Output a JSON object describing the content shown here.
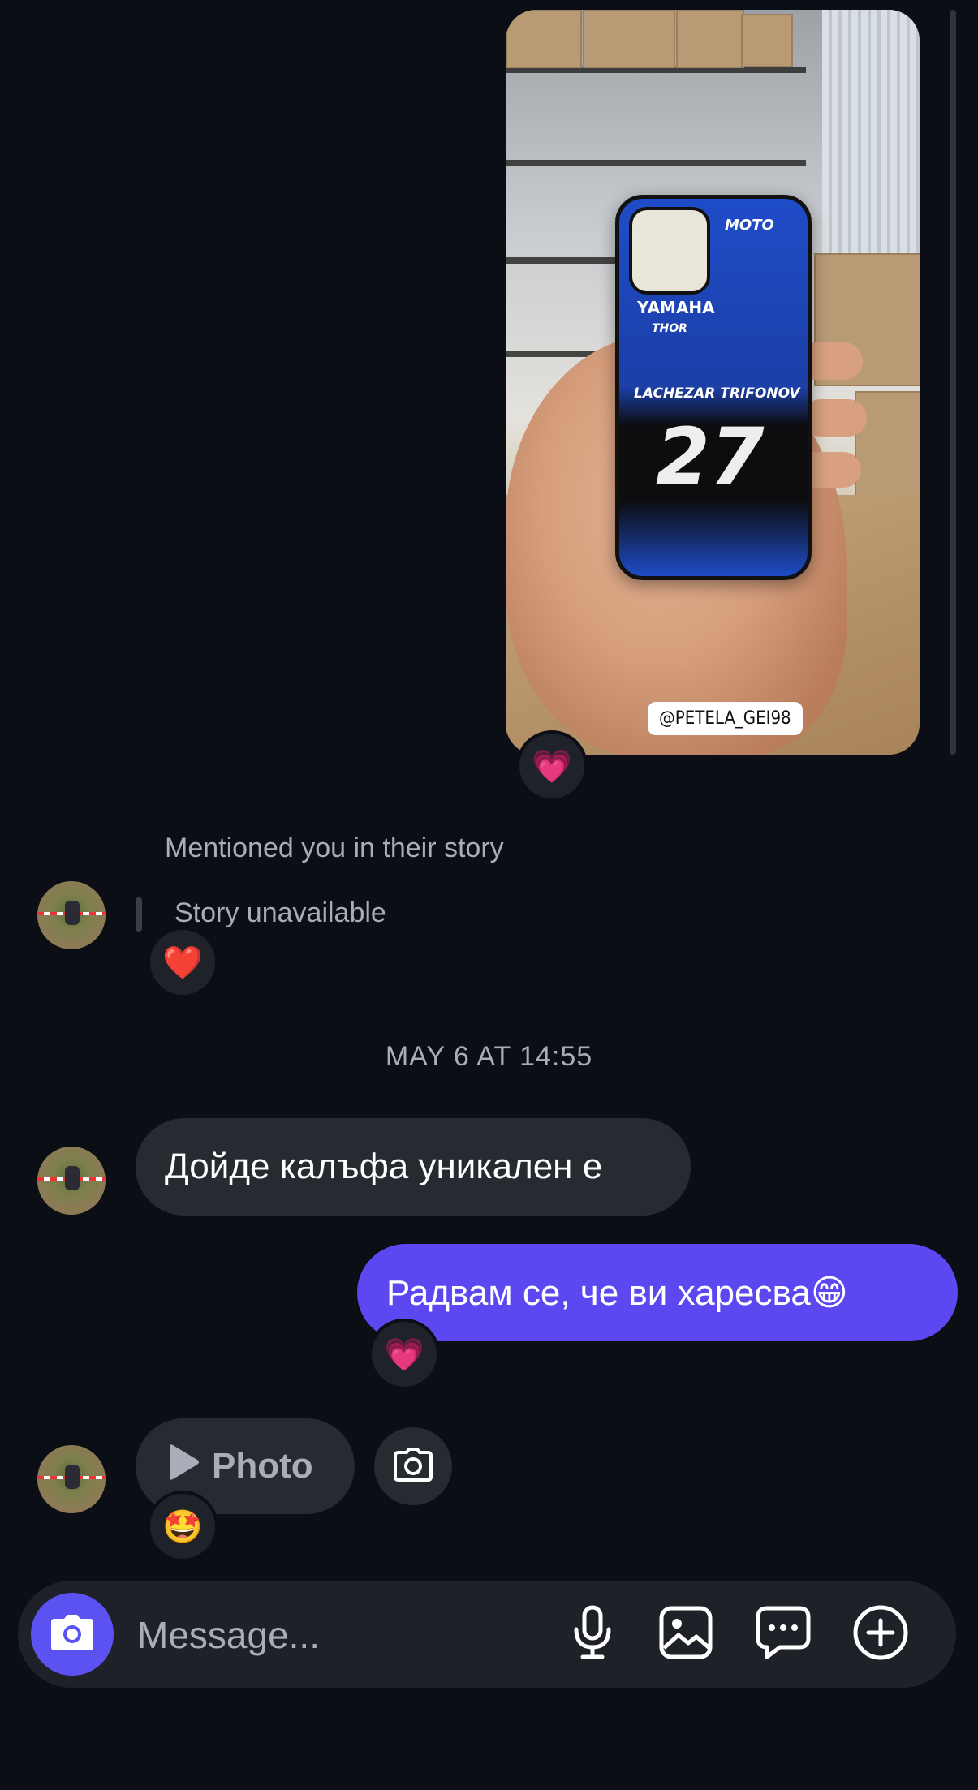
{
  "story_share": {
    "photo_alt_subject": "phone case held in hand",
    "case_brand": "YAMAHA",
    "case_sub": "THOR",
    "case_name": "LACHEZAR TRIFONOV",
    "case_number": "27",
    "case_top_logo": "MOTO",
    "mention_tag": "@PETELA_GEI98",
    "reaction": "💗"
  },
  "story_mention": {
    "label": "Mentioned you in their story",
    "status": "Story unavailable",
    "reaction": "❤️"
  },
  "date_separator": "MAY 6 AT 14:55",
  "messages": [
    {
      "direction": "in",
      "text": "Дойде калъфа уникален е"
    },
    {
      "direction": "out",
      "text": "Радвам се, че ви харесва😁",
      "reaction": "💗"
    },
    {
      "direction": "in",
      "text": "Photo",
      "icon": "play-icon",
      "reaction": "🤩"
    }
  ],
  "composer": {
    "placeholder": "Message...",
    "icons": [
      "camera-icon",
      "microphone-icon",
      "gallery-icon",
      "chat-bubble-icon",
      "plus-icon"
    ]
  },
  "colors": {
    "background": "#0b0e14",
    "incoming_bubble": "#262a31",
    "outgoing_bubble": "#5b48f0",
    "camera_button": "#5c52f2"
  }
}
